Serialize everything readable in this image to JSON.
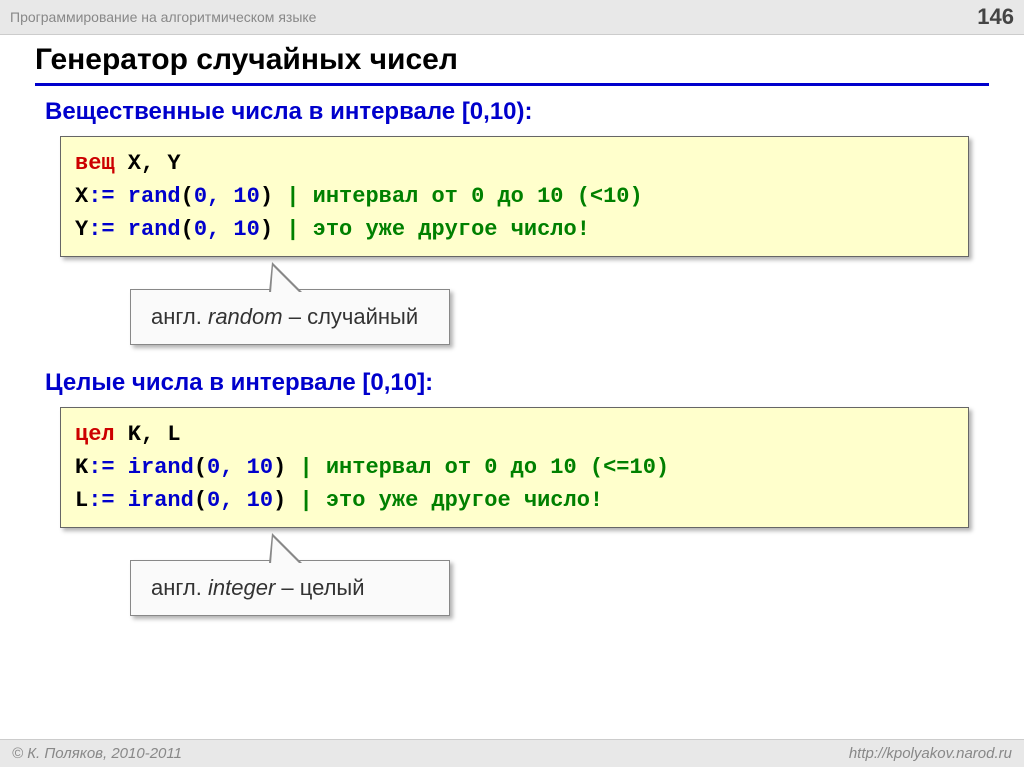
{
  "header": {
    "course": "Программирование на алгоритмическом языке",
    "page": "146"
  },
  "title": "Генератор случайных чисел",
  "section1": {
    "heading": "Вещественные числа в интервале [0,10):",
    "code": {
      "l1_kw": "вещ",
      "l1_vars": " X, Y",
      "l2_var": "X",
      "l2_assign": ":=",
      "l2_fn": " rand",
      "l2_paren1": "(",
      "l2_args": "0, 10",
      "l2_paren2": ")",
      "l2_cmt": " | интервал от 0 до 10 (<10)",
      "l3_var": "Y",
      "l3_assign": ":=",
      "l3_fn": " rand",
      "l3_paren1": "(",
      "l3_args": "0, 10",
      "l3_paren2": ")",
      "l3_cmt": " | это уже другое число!"
    },
    "callout_pre": "англ. ",
    "callout_word": "random ",
    "callout_post": "– случайный"
  },
  "section2": {
    "heading": "Целые числа в интервале [0,10]:",
    "code": {
      "l1_kw": "цел",
      "l1_vars": " K, L",
      "l2_var": "K",
      "l2_assign": ":=",
      "l2_fn": " irand",
      "l2_paren1": "(",
      "l2_args": "0, 10",
      "l2_paren2": ")",
      "l2_cmt": " | интервал от 0 до 10 (<=10)",
      "l3_var": "L",
      "l3_assign": ":=",
      "l3_fn": " irand",
      "l3_paren1": "(",
      "l3_args": "0, 10",
      "l3_paren2": ")",
      "l3_cmt": " | это уже другое число!"
    },
    "callout_pre": "англ. ",
    "callout_word": "integer ",
    "callout_post": "– целый"
  },
  "footer": {
    "left": "© К. Поляков, 2010-2011",
    "right": "http://kpolyakov.narod.ru"
  }
}
